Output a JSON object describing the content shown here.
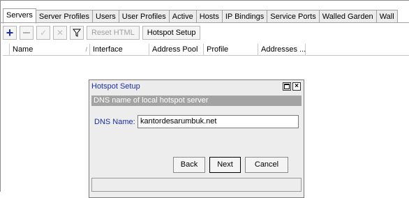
{
  "tabs": [
    "Servers",
    "Server Profiles",
    "Users",
    "User Profiles",
    "Active",
    "Hosts",
    "IP Bindings",
    "Service Ports",
    "Walled Garden",
    "Wall"
  ],
  "toolbar": {
    "reset_html": "Reset HTML",
    "hotspot_setup": "Hotspot Setup"
  },
  "table": {
    "columns": [
      "Name",
      "Interface",
      "Address Pool",
      "Profile",
      "Addresses ..."
    ]
  },
  "dialog": {
    "title": "Hotspot Setup",
    "subheader": "DNS name of local hotspot server",
    "dns_label": "DNS Name:",
    "dns_value": "kantordesarumbuk.net",
    "back": "Back",
    "next": "Next",
    "cancel": "Cancel",
    "close_symbol": "×"
  }
}
